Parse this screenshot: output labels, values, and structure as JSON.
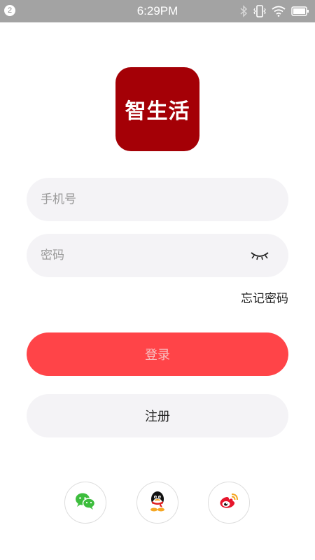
{
  "status_bar": {
    "notification_count": "2",
    "time": "6:29PM",
    "icons": [
      "bluetooth-icon",
      "vibrate-icon",
      "wifi-icon",
      "battery-icon"
    ]
  },
  "logo": {
    "text": "智生活",
    "color": "#a40006"
  },
  "form": {
    "phone_placeholder": "手机号",
    "password_placeholder": "密码",
    "password_visibility_icon": "eye-closed-icon",
    "forgot_password_label": "忘记密码"
  },
  "actions": {
    "login_label": "登录",
    "login_color": "#ff4448",
    "register_label": "注册"
  },
  "social_login": {
    "providers": [
      {
        "icon": "wechat-icon",
        "color": "#3dbd3d"
      },
      {
        "icon": "qq-icon",
        "color": "#000000"
      },
      {
        "icon": "weibo-icon",
        "color": "#e6162d"
      }
    ]
  }
}
